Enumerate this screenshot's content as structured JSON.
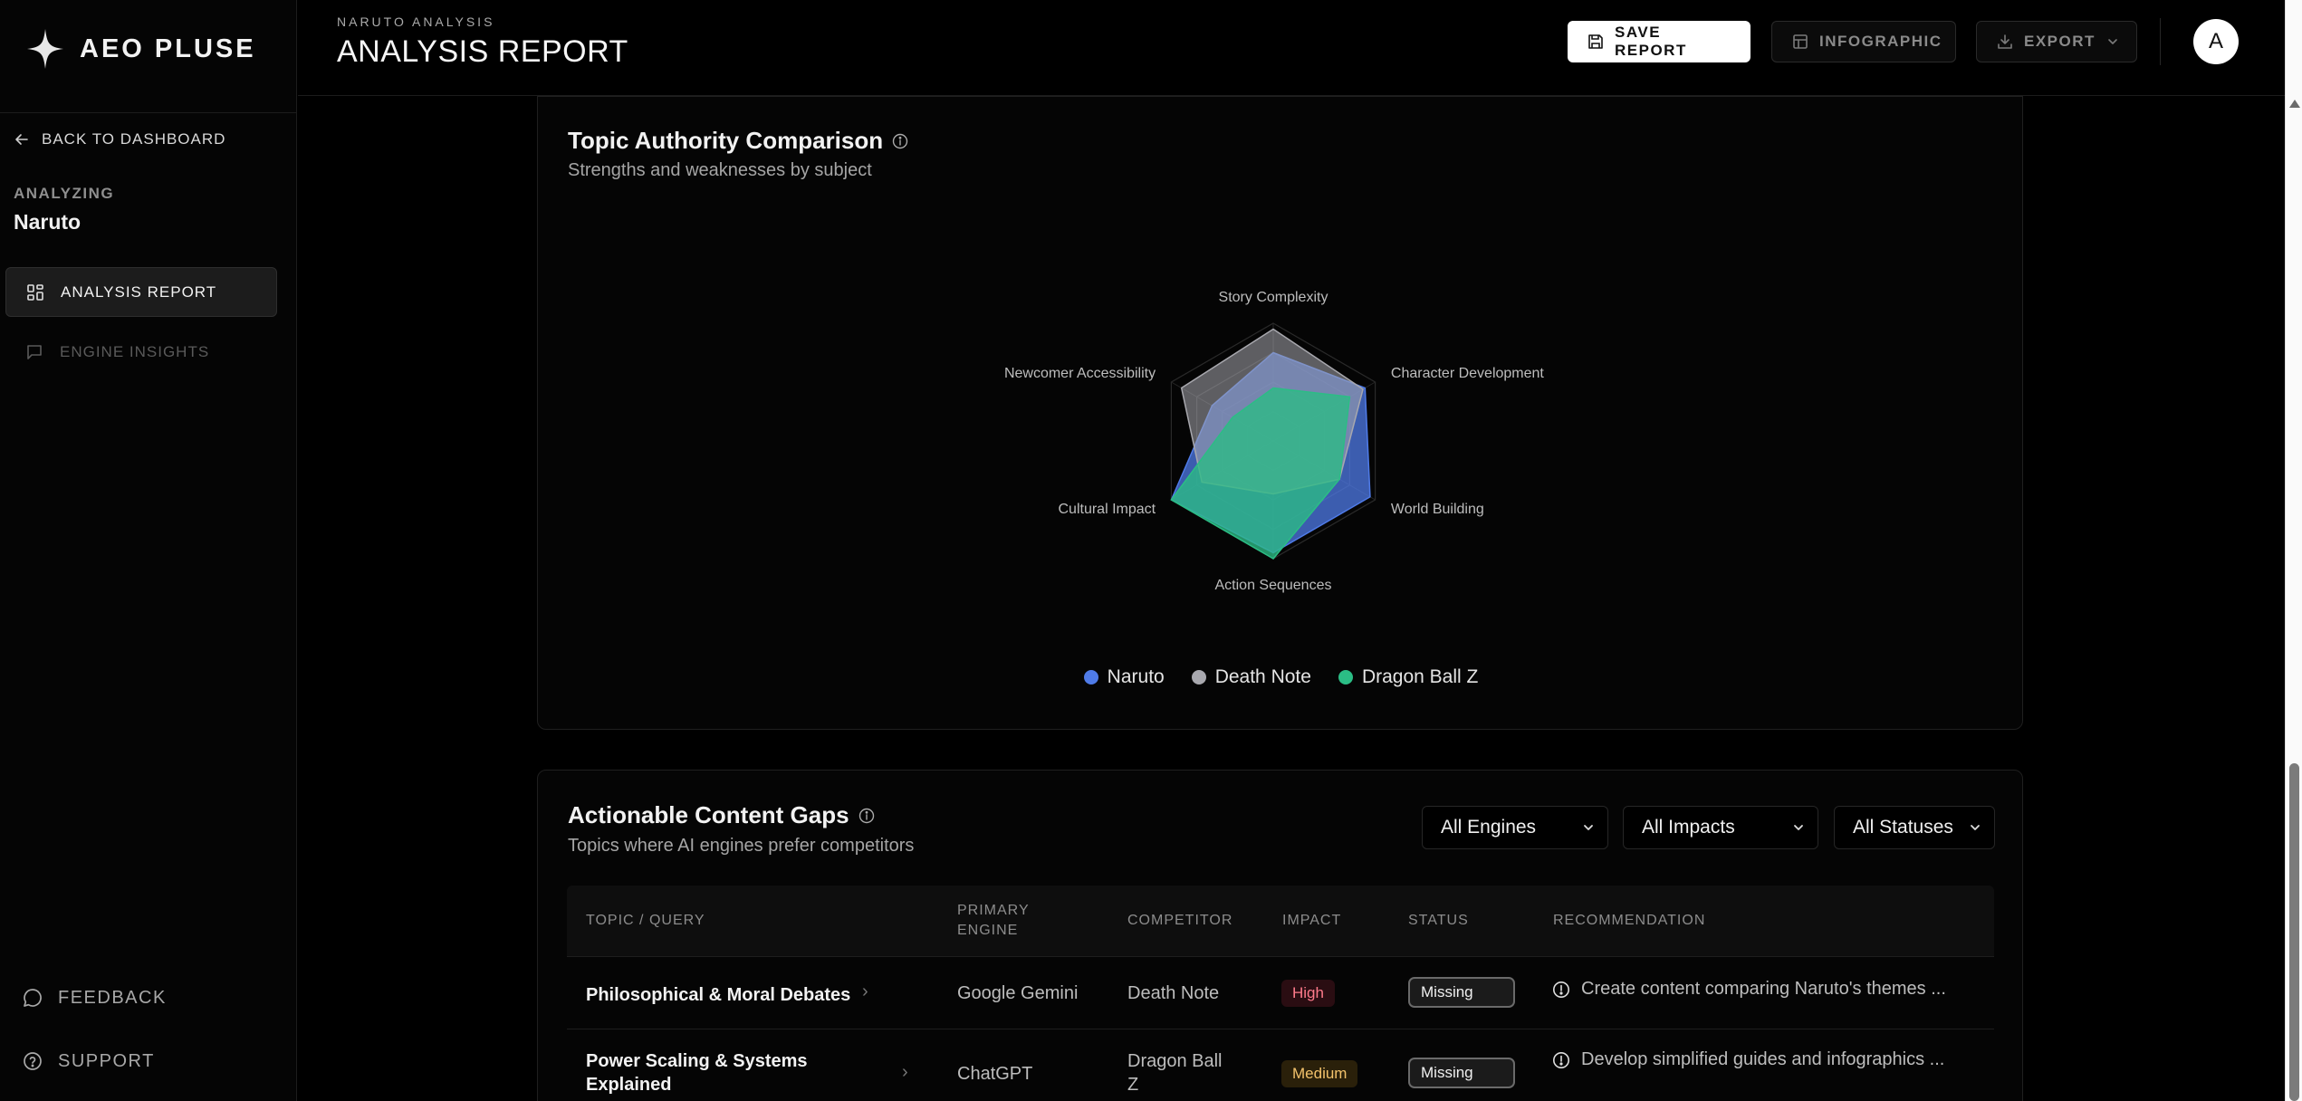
{
  "brand": {
    "name": "AEO PLUSE"
  },
  "sidebar": {
    "back_label": "BACK TO DASHBOARD",
    "analyzing_label": "ANALYZING",
    "analyzing_value": "Naruto",
    "nav": [
      {
        "label": "ANALYSIS REPORT",
        "icon": "grid-icon",
        "active": true
      },
      {
        "label": "ENGINE INSIGHTS",
        "icon": "message-square-icon",
        "active": false
      }
    ],
    "footer": [
      {
        "label": "FEEDBACK",
        "icon": "message-circle-icon"
      },
      {
        "label": "SUPPORT",
        "icon": "help-circle-icon"
      }
    ]
  },
  "header": {
    "eyebrow": "NARUTO ANALYSIS",
    "title": "ANALYSIS REPORT",
    "save_label": "SAVE REPORT",
    "infographic_label": "INFOGRAPHIC",
    "export_label": "EXPORT",
    "avatar_initial": "A"
  },
  "topic_card": {
    "title": "Topic Authority Comparison",
    "subtitle": "Strengths and weaknesses by subject"
  },
  "chart_data": {
    "type": "radar",
    "axes": [
      "Story Complexity",
      "Character Development",
      "World Building",
      "Action Sequences",
      "Cultural Impact",
      "Newcomer Accessibility"
    ],
    "range": [
      0,
      100
    ],
    "grid": true,
    "legend_position": "bottom",
    "series": [
      {
        "name": "Naruto",
        "color": "#4f7be8",
        "values": [
          75,
          90,
          95,
          95,
          100,
          60
        ]
      },
      {
        "name": "Death Note",
        "color": "#a8a8ae",
        "values": [
          95,
          88,
          65,
          45,
          70,
          90
        ]
      },
      {
        "name": "Dragon Ball Z",
        "color": "#2bbd85",
        "values": [
          45,
          75,
          65,
          100,
          100,
          40
        ]
      }
    ]
  },
  "gaps_card": {
    "title": "Actionable Content Gaps",
    "subtitle": "Topics where AI engines prefer competitors",
    "filters": [
      "All Engines",
      "All Impacts",
      "All Statuses"
    ],
    "columns": {
      "topic": "TOPIC / QUERY",
      "engine_line1": "PRIMARY",
      "engine_line2": "ENGINE",
      "competitor": "COMPETITOR",
      "impact": "IMPACT",
      "status": "STATUS",
      "recommendation": "RECOMMENDATION"
    },
    "rows": [
      {
        "topic_line1": "Philosophical & Moral Debates",
        "topic_line2": "",
        "engine": "Google Gemini",
        "competitor_line1": "Death Note",
        "competitor_line2": "",
        "impact": "High",
        "status": "Missing",
        "recommendation": "Create content comparing Naruto's themes ..."
      },
      {
        "topic_line1": "Power Scaling & Systems",
        "topic_line2": "Explained",
        "engine": "ChatGPT",
        "competitor_line1": "Dragon Ball",
        "competitor_line2": "Z",
        "impact": "Medium",
        "status": "Missing",
        "recommendation": "Develop simplified guides and infographics ..."
      }
    ]
  }
}
